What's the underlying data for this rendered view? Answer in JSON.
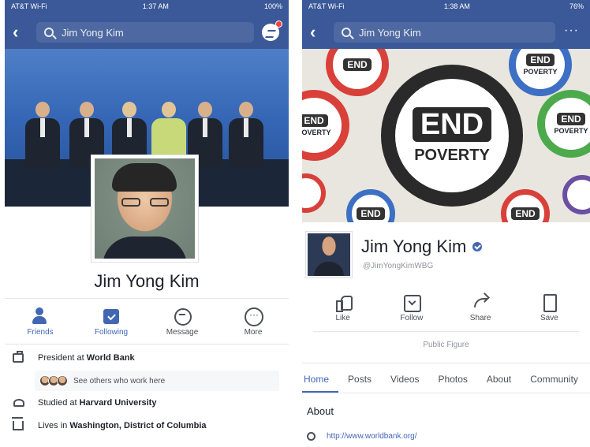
{
  "left": {
    "status": {
      "carrier": "AT&T Wi-Fi",
      "time": "1:37 AM",
      "battery": "100%"
    },
    "search": {
      "query": "Jim Yong Kim"
    },
    "profile": {
      "name": "Jim Yong Kim"
    },
    "actions": [
      {
        "label": "Friends",
        "icon": "add-friend-icon",
        "active": true
      },
      {
        "label": "Following",
        "icon": "following-icon",
        "active": true
      },
      {
        "label": "Message",
        "icon": "messenger-icon",
        "active": false
      },
      {
        "label": "More",
        "icon": "more-icon",
        "active": false
      }
    ],
    "info": {
      "work_prefix": "President at ",
      "work_place": "World Bank",
      "colleagues": "See others who work here",
      "edu_prefix": "Studied at ",
      "edu_place": "Harvard University",
      "home_prefix": "Lives in ",
      "home_place": "Washington, District of Columbia"
    }
  },
  "right": {
    "status": {
      "carrier": "AT&T Wi-Fi",
      "time": "1:38 AM",
      "battery": "76%"
    },
    "search": {
      "query": "Jim Yong Kim"
    },
    "cover": {
      "word1": "END",
      "word2": "POVERTY"
    },
    "page": {
      "name": "Jim Yong Kim",
      "username": "@JimYongKimWBG"
    },
    "actions": [
      {
        "label": "Like",
        "icon": "like-icon"
      },
      {
        "label": "Follow",
        "icon": "follow-icon"
      },
      {
        "label": "Share",
        "icon": "share-icon"
      },
      {
        "label": "Save",
        "icon": "save-icon"
      }
    ],
    "category": "Public Figure",
    "tabs": [
      "Home",
      "Posts",
      "Videos",
      "Photos",
      "About",
      "Community"
    ],
    "about": {
      "heading": "About",
      "website": "http://www.worldbank.org/"
    }
  },
  "colors": {
    "facebook_blue": "#3b5998",
    "accent": "#4267b2",
    "badge": "#fa3e3e"
  }
}
